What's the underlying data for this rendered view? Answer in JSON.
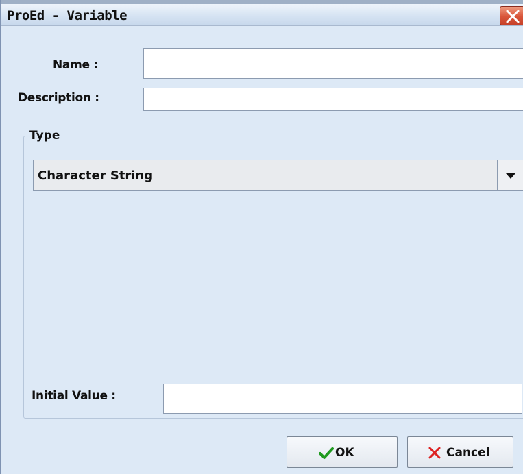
{
  "window": {
    "title": "ProEd - Variable",
    "close_icon": "close-icon"
  },
  "form": {
    "name_label": "Name :",
    "name_value": "",
    "description_label": "Description :",
    "description_value": "",
    "type_group_title": "Type",
    "type_selected": "Character String",
    "initial_value_label": "Initial Value :",
    "initial_value_value": ""
  },
  "buttons": {
    "ok_label": "OK",
    "cancel_label": "Cancel"
  },
  "colors": {
    "background": "#dde9f6",
    "close": "#d9553a",
    "ok_check": "#1f9a1f",
    "cancel_x": "#d22"
  }
}
